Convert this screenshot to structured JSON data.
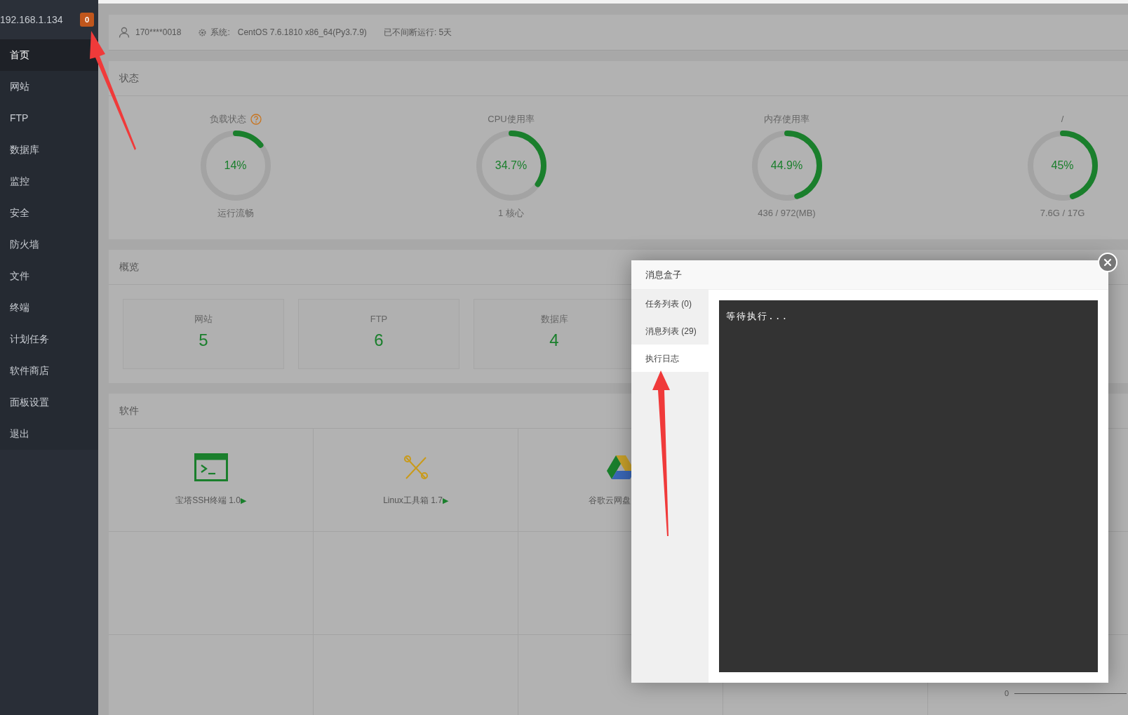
{
  "sidebar": {
    "host": "192.168.1.134",
    "badge": "0",
    "items": [
      {
        "label": "首页",
        "selected": true
      },
      {
        "label": "网站",
        "selected": false
      },
      {
        "label": "FTP",
        "selected": false
      },
      {
        "label": "数据库",
        "selected": false
      },
      {
        "label": "监控",
        "selected": false
      },
      {
        "label": "安全",
        "selected": false
      },
      {
        "label": "防火墙",
        "selected": false
      },
      {
        "label": "文件",
        "selected": false
      },
      {
        "label": "终端",
        "selected": false
      },
      {
        "label": "计划任务",
        "selected": false
      },
      {
        "label": "软件商店",
        "selected": false
      },
      {
        "label": "面板设置",
        "selected": false
      },
      {
        "label": "退出",
        "selected": false
      }
    ]
  },
  "top_bar": {
    "user": "170****0018",
    "system_label": "系统:",
    "system": "CentOS 7.6.1810 x86_64(Py3.7.9)",
    "uptime": "已不间断运行: 5天"
  },
  "status": {
    "title": "状态",
    "gauges": [
      {
        "label": "负载状态",
        "help": true,
        "value": "14%",
        "level": 0.14,
        "caption": "运行流畅"
      },
      {
        "label": "CPU使用率",
        "help": false,
        "value": "34.7%",
        "level": 0.347,
        "caption": "1 核心"
      },
      {
        "label": "内存使用率",
        "help": false,
        "value": "44.9%",
        "level": 0.449,
        "caption": "436 / 972(MB)"
      },
      {
        "label": "/",
        "help": false,
        "value": "45%",
        "level": 0.45,
        "caption": "7.6G / 17G"
      }
    ]
  },
  "overview": {
    "title": "概览",
    "cards": [
      {
        "label": "网站",
        "value": "5"
      },
      {
        "label": "FTP",
        "value": "6"
      },
      {
        "label": "数据库",
        "value": "4"
      }
    ]
  },
  "software": {
    "title": "软件",
    "items": [
      {
        "kind": "terminal",
        "label": "宝塔SSH终端 1.0",
        "arrow": "▶"
      },
      {
        "kind": "tools",
        "label": "Linux工具箱 1.7",
        "arrow": "▶"
      },
      {
        "kind": "drive",
        "label": "谷歌云网盘"
      }
    ]
  },
  "chart_fragment": {
    "label": "0"
  },
  "dialog": {
    "title": "消息盒子",
    "tabs": [
      {
        "label": "任务列表 (0)",
        "selected": false
      },
      {
        "label": "消息列表 (29)",
        "selected": false
      },
      {
        "label": "执行日志",
        "selected": true
      }
    ],
    "log": "等待执行..."
  }
}
